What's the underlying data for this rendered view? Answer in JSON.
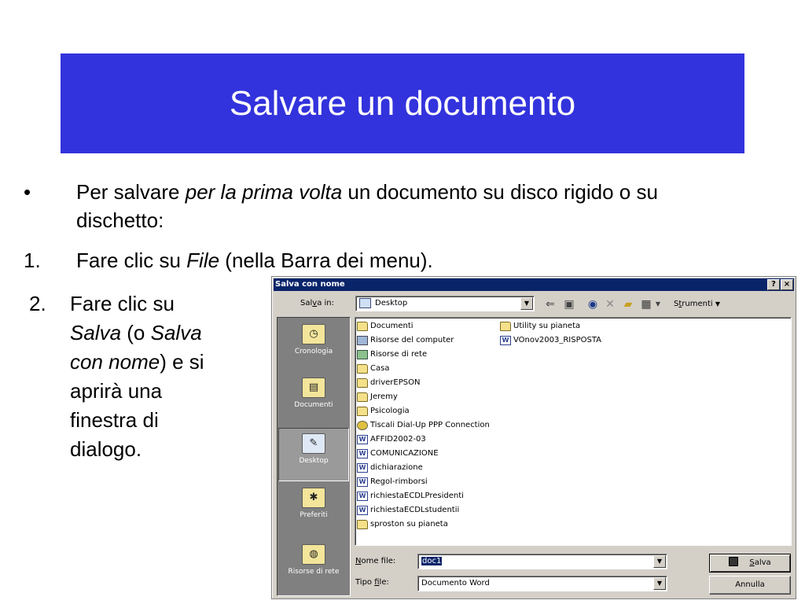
{
  "slide": {
    "title": "Salvare un documento",
    "bullet1": {
      "marker": "•",
      "pre": "Per salvare ",
      "italic": "per la prima volta",
      "post": " un documento su disco rigido o su dischetto:"
    },
    "step1": {
      "marker": "1.",
      "pre": "Fare clic su ",
      "italic": "File",
      "post": " (nella Barra dei menu)."
    },
    "step2": {
      "marker": "2.",
      "pre": "Fare clic su ",
      "italic1": "Salva",
      "mid": " (o ",
      "italic2": "Salva con nome",
      "post": ") e si aprirà una finestra di dialogo."
    },
    "colors": {
      "title_bg": "#3333dd",
      "title_text": "#ffffff"
    }
  },
  "dialog": {
    "title": "Salva con nome",
    "help_label": "?",
    "close_label": "×",
    "save_in_label": {
      "pre": "Sal",
      "u": "v",
      "post": "a in:"
    },
    "save_in_value": "Desktop",
    "toolbar": {
      "back_icon": "back-arrow-icon",
      "up_icon": "up-folder-icon",
      "search_icon": "search-web-icon",
      "delete_icon": "delete-icon",
      "new_folder_icon": "new-folder-icon",
      "views_icon": "views-icon",
      "tools_label": {
        "pre": "S",
        "u": "t",
        "post": "rumenti"
      }
    },
    "places": [
      {
        "label": "Cronologia",
        "icon": "history-icon"
      },
      {
        "label": "Documenti",
        "icon": "my-documents-icon"
      },
      {
        "label": "Desktop",
        "icon": "desktop-icon"
      },
      {
        "label": "Preferiti",
        "icon": "favorites-icon"
      },
      {
        "label": "Risorse di rete",
        "icon": "network-places-icon"
      }
    ],
    "files_col1": [
      {
        "name": "Documenti",
        "icon": "folder-docs"
      },
      {
        "name": "Risorse del computer",
        "icon": "computer"
      },
      {
        "name": "Risorse di rete",
        "icon": "network"
      },
      {
        "name": "Casa",
        "icon": "folder"
      },
      {
        "name": "driverEPSON",
        "icon": "folder"
      },
      {
        "name": "Jeremy",
        "icon": "folder"
      },
      {
        "name": "Psicologia",
        "icon": "folder"
      },
      {
        "name": "Tiscali Dial-Up PPP Connection",
        "icon": "dialup"
      },
      {
        "name": "AFFID2002-03",
        "icon": "word"
      },
      {
        "name": "COMUNICAZIONE",
        "icon": "word"
      },
      {
        "name": "dichiarazione",
        "icon": "word"
      },
      {
        "name": "Regol-rimborsi",
        "icon": "word"
      },
      {
        "name": "richiestaECDLPresidenti",
        "icon": "word"
      },
      {
        "name": "richiestaECDLstudentii",
        "icon": "word"
      },
      {
        "name": "sproston su pianeta",
        "icon": "folder-shortcut"
      }
    ],
    "files_col2": [
      {
        "name": "Utility su pianeta",
        "icon": "folder-shortcut"
      },
      {
        "name": "VOnov2003_RISPOSTA",
        "icon": "word"
      }
    ],
    "filename_label": {
      "u": "N",
      "post": "ome file:"
    },
    "filename_value": "doc1",
    "filetype_label": {
      "pre": "Tipo ",
      "u": "f",
      "post": "ile:"
    },
    "filetype_value": "Documento Word",
    "save_button": {
      "u": "S",
      "post": "alva"
    },
    "cancel_button": "Annulla",
    "colors": {
      "titlebar": "#0a246a",
      "face": "#d4d0c8",
      "places_bg": "#808080"
    }
  }
}
